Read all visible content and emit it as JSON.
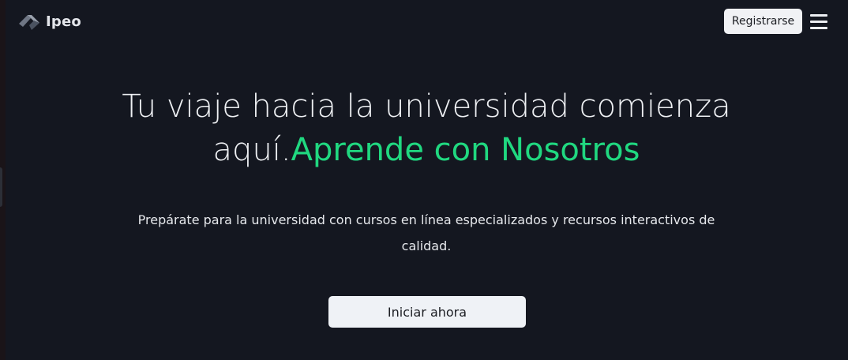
{
  "header": {
    "brand": {
      "name": "Ipeo",
      "logo_icon": "ipeo-logo-icon"
    },
    "register_label": "Registrarse",
    "menu_icon": "hamburger-menu-icon"
  },
  "hero": {
    "title_main": "Tu viaje hacia la universidad comienza aquí.",
    "title_accent": "Aprende con Nosotros",
    "description": "Prepárate para la universidad con cursos en línea especializados y recursos interactivos de calidad.",
    "cta_label": "Iniciar ahora"
  },
  "colors": {
    "background": "#141720",
    "accent": "#20d880",
    "button_bg": "#eff2f6",
    "text": "#eef0f3"
  }
}
